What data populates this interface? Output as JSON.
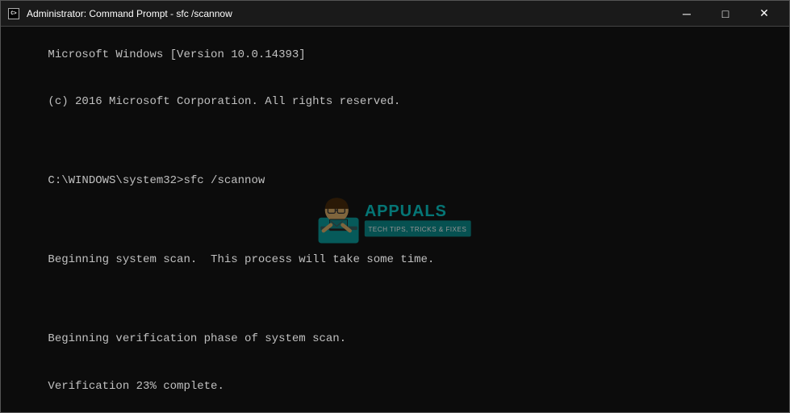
{
  "window": {
    "title": "Administrator: Command Prompt - sfc  /scannow",
    "icon": "cmd-icon"
  },
  "titlebar": {
    "minimize_label": "─",
    "maximize_label": "□",
    "close_label": "✕"
  },
  "terminal": {
    "line1": "Microsoft Windows [Version 10.0.14393]",
    "line2": "(c) 2016 Microsoft Corporation. All rights reserved.",
    "line3": "",
    "line4": "C:\\WINDOWS\\system32>sfc /scannow",
    "line5": "",
    "line6": "Beginning system scan.  This process will take some time.",
    "line7": "",
    "line8": "Beginning verification phase of system scan.",
    "line9": "Verification 23% complete."
  }
}
